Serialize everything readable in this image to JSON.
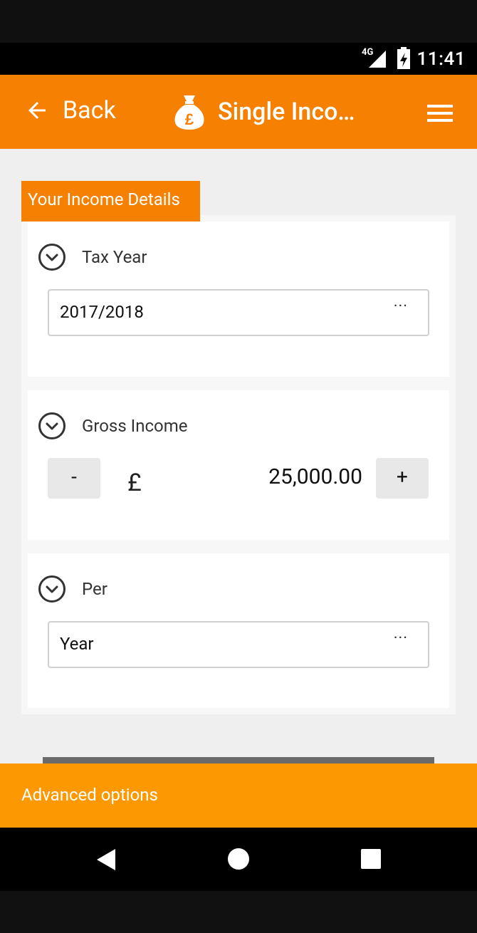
{
  "status_bar": {
    "network": "4G",
    "time": "11:41"
  },
  "app_bar": {
    "back_label": "Back",
    "title": "Single Inco…"
  },
  "section_title": "Your Income Details",
  "tax_year": {
    "label": "Tax Year",
    "value": "2017/2018",
    "more": "···"
  },
  "gross_income": {
    "label": "Gross Income",
    "minus": "-",
    "currency": "£",
    "value": "25,000.00",
    "plus": "+"
  },
  "per": {
    "label": "Per",
    "value": "Year",
    "more": "···"
  },
  "advanced_options": "Advanced options",
  "colors": {
    "accent": "#f58002",
    "advanced_bar": "#fb9802"
  },
  "icons": [
    "back-arrow-icon",
    "money-bag-pound-icon",
    "hamburger-menu-icon",
    "chevron-down-circle-icon",
    "signal-icon",
    "battery-icon",
    "nav-back-icon",
    "nav-home-icon",
    "nav-recents-icon"
  ]
}
